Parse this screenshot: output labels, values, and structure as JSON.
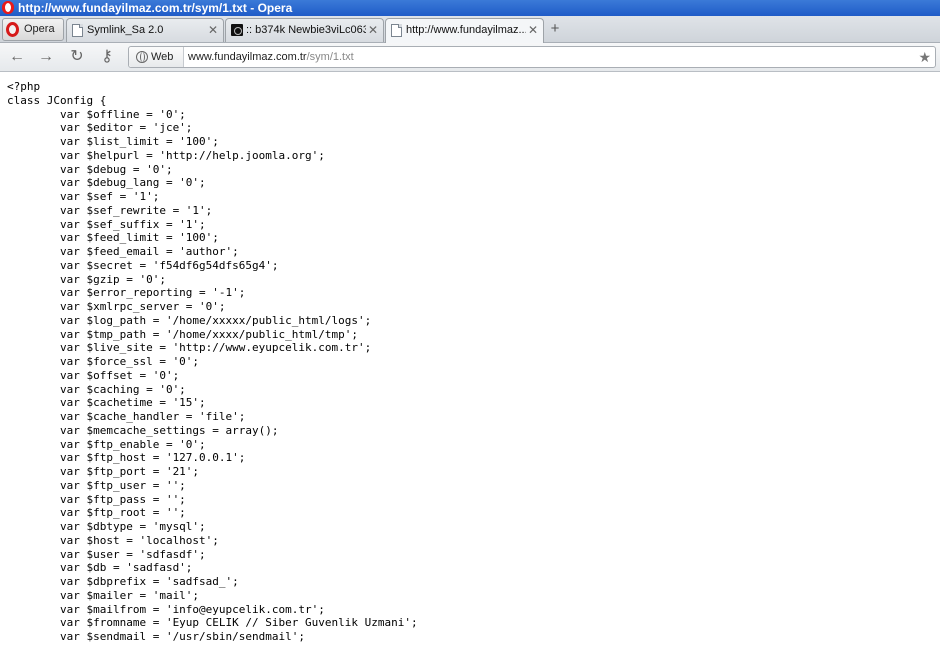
{
  "window": {
    "title": "http://www.fundayilmaz.com.tr/sym/1.txt - Opera"
  },
  "menu_button": {
    "label": "Opera"
  },
  "tabs": [
    {
      "label": "Symlink_Sa 2.0",
      "favicon": "page-icon",
      "active": false
    },
    {
      "label": ":: b374k Newbie3viLc063...",
      "favicon": "shell-icon",
      "active": false
    },
    {
      "label": "http://www.fundayilmaz...",
      "favicon": "page-icon",
      "active": true
    }
  ],
  "nav": {
    "web_label": "Web",
    "url_domain": "www.fundayilmaz.com.tr",
    "url_path": "/sym/1.txt"
  },
  "document": {
    "lines": [
      "<?php",
      "class JConfig {",
      "\tvar $offline = '0';",
      "\tvar $editor = 'jce';",
      "\tvar $list_limit = '100';",
      "\tvar $helpurl = 'http://help.joomla.org';",
      "\tvar $debug = '0';",
      "\tvar $debug_lang = '0';",
      "\tvar $sef = '1';",
      "\tvar $sef_rewrite = '1';",
      "\tvar $sef_suffix = '1';",
      "\tvar $feed_limit = '100';",
      "\tvar $feed_email = 'author';",
      "\tvar $secret = 'f54df6g54dfs65g4';",
      "\tvar $gzip = '0';",
      "\tvar $error_reporting = '-1';",
      "\tvar $xmlrpc_server = '0';",
      "\tvar $log_path = '/home/xxxxx/public_html/logs';",
      "\tvar $tmp_path = '/home/xxxx/public_html/tmp';",
      "\tvar $live_site = 'http://www.eyupcelik.com.tr';",
      "\tvar $force_ssl = '0';",
      "\tvar $offset = '0';",
      "\tvar $caching = '0';",
      "\tvar $cachetime = '15';",
      "\tvar $cache_handler = 'file';",
      "\tvar $memcache_settings = array();",
      "\tvar $ftp_enable = '0';",
      "\tvar $ftp_host = '127.0.0.1';",
      "\tvar $ftp_port = '21';",
      "\tvar $ftp_user = '';",
      "\tvar $ftp_pass = '';",
      "\tvar $ftp_root = '';",
      "\tvar $dbtype = 'mysql';",
      "\tvar $host = 'localhost';",
      "\tvar $user = 'sdfasdf';",
      "\tvar $db = 'sadfasd';",
      "\tvar $dbprefix = 'sadfsad_';",
      "\tvar $mailer = 'mail';",
      "\tvar $mailfrom = 'info@eyupcelik.com.tr';",
      "\tvar $fromname = 'Eyup CELIK // Siber Guvenlik Uzmani';",
      "\tvar $sendmail = '/usr/sbin/sendmail';"
    ]
  }
}
